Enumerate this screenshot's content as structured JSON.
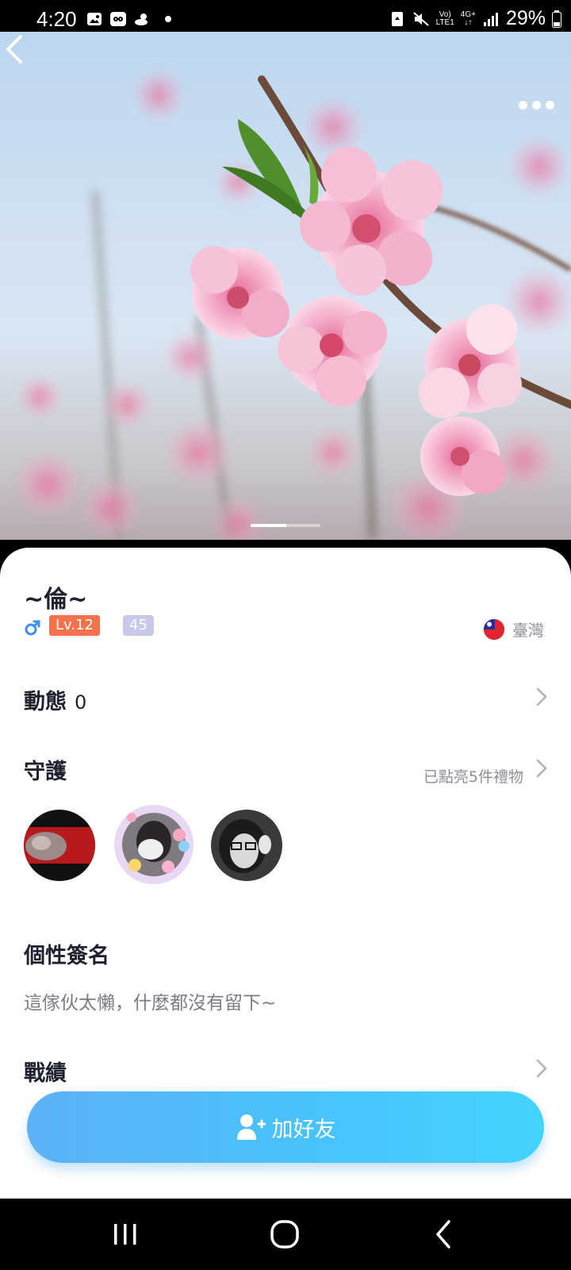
{
  "status_bar": {
    "time": "4:20",
    "network_top": "Vo)",
    "network_bottom": "LTE1",
    "data_type": "4G+",
    "battery": "29%"
  },
  "profile": {
    "nickname": "~倫~",
    "gender_icon": "male-icon",
    "level": "Lv.12",
    "badge_number": "45",
    "country": "臺灣",
    "country_flag": "taiwan-flag-icon"
  },
  "rows": {
    "moments_label": "動態",
    "moments_count": "0",
    "guard_label": "守護",
    "guard_sub": "已點亮5件禮物",
    "signature_label": "個性簽名",
    "signature_text": "這傢伙太懶，什麼都沒有留下~",
    "record_label": "戰績"
  },
  "actions": {
    "add_friend": "加好友"
  },
  "colors": {
    "level_badge": "#f4724c",
    "number_badge": "#c9c8eb",
    "button_start": "#5cb1f7",
    "button_end": "#43d4fd",
    "male": "#3d8ff0"
  }
}
